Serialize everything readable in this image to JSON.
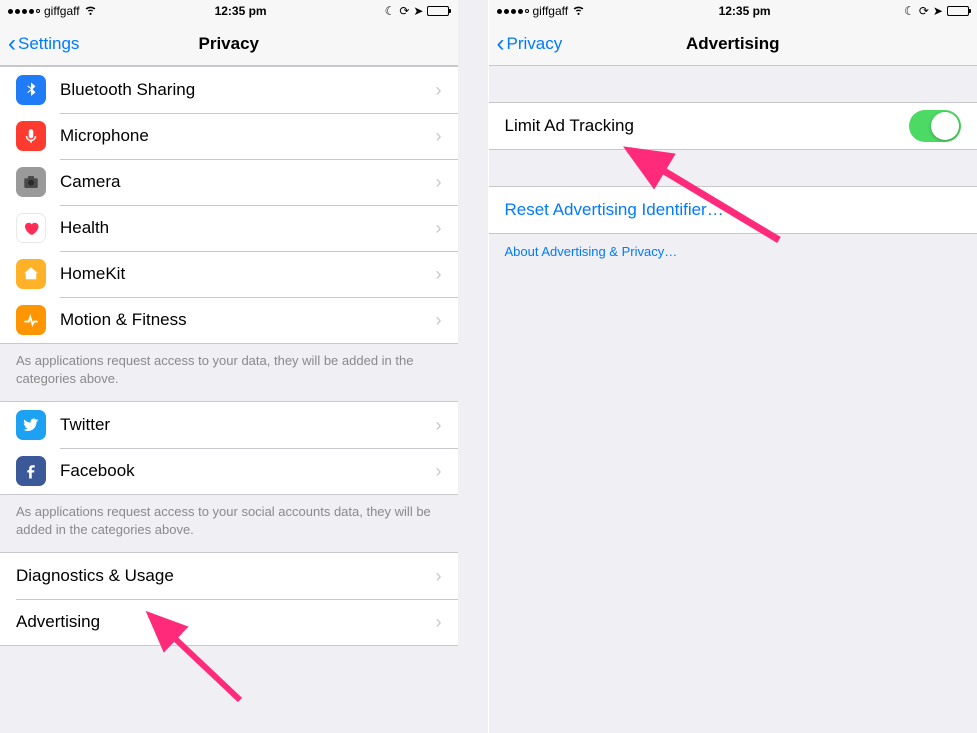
{
  "left": {
    "status": {
      "carrier": "giffgaff",
      "time": "12:35 pm"
    },
    "nav": {
      "back": "Settings",
      "title": "Privacy"
    },
    "group1": [
      {
        "key": "bluetooth",
        "label": "Bluetooth Sharing",
        "iconClass": "ic-bluetooth",
        "iconName": "bluetooth-icon"
      },
      {
        "key": "microphone",
        "label": "Microphone",
        "iconClass": "ic-mic",
        "iconName": "microphone-icon"
      },
      {
        "key": "camera",
        "label": "Camera",
        "iconClass": "ic-camera",
        "iconName": "camera-icon"
      },
      {
        "key": "health",
        "label": "Health",
        "iconClass": "ic-health",
        "iconName": "health-icon"
      },
      {
        "key": "homekit",
        "label": "HomeKit",
        "iconClass": "ic-homekit",
        "iconName": "homekit-icon"
      },
      {
        "key": "motion",
        "label": "Motion & Fitness",
        "iconClass": "ic-motion",
        "iconName": "motion-icon"
      }
    ],
    "footer1": "As applications request access to your data, they will be added in the categories above.",
    "group2": [
      {
        "key": "twitter",
        "label": "Twitter",
        "iconClass": "ic-twitter",
        "iconName": "twitter-icon"
      },
      {
        "key": "facebook",
        "label": "Facebook",
        "iconClass": "ic-facebook",
        "iconName": "facebook-icon"
      }
    ],
    "footer2": "As applications request access to your social accounts data, they will be added in the categories above.",
    "group3": [
      {
        "key": "diagnostics",
        "label": "Diagnostics & Usage"
      },
      {
        "key": "advertising",
        "label": "Advertising"
      }
    ]
  },
  "right": {
    "status": {
      "carrier": "giffgaff",
      "time": "12:35 pm"
    },
    "nav": {
      "back": "Privacy",
      "title": "Advertising"
    },
    "toggleRow": {
      "label": "Limit Ad Tracking",
      "on": true
    },
    "resetRow": {
      "label": "Reset Advertising Identifier…"
    },
    "aboutRow": {
      "label": "About Advertising & Privacy…"
    }
  }
}
